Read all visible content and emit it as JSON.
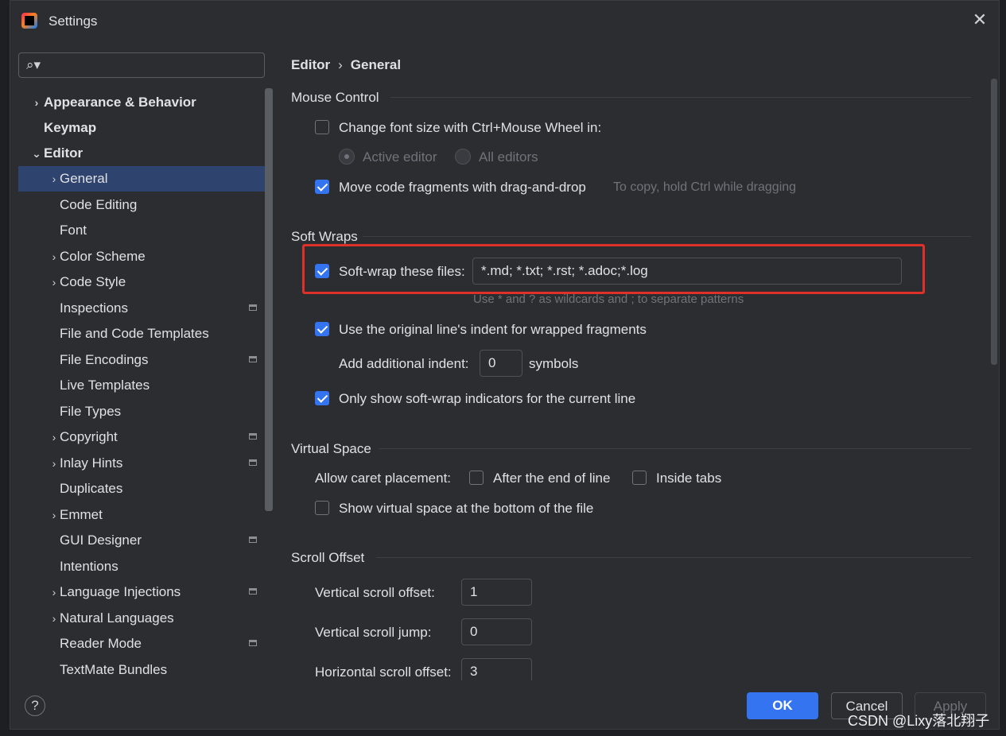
{
  "window": {
    "title": "Settings",
    "close_label": "✕"
  },
  "search": {
    "icon": "search-icon"
  },
  "sidebar": {
    "items": [
      {
        "label": "Appearance & Behavior",
        "chevron": "›"
      },
      {
        "label": "Keymap"
      },
      {
        "label": "Editor",
        "chevron": "⌄"
      },
      {
        "label": "General",
        "chevron": "›"
      },
      {
        "label": "Code Editing"
      },
      {
        "label": "Font"
      },
      {
        "label": "Color Scheme",
        "chevron": "›"
      },
      {
        "label": "Code Style",
        "chevron": "›"
      },
      {
        "label": "Inspections"
      },
      {
        "label": "File and Code Templates"
      },
      {
        "label": "File Encodings"
      },
      {
        "label": "Live Templates"
      },
      {
        "label": "File Types"
      },
      {
        "label": "Copyright",
        "chevron": "›"
      },
      {
        "label": "Inlay Hints",
        "chevron": "›"
      },
      {
        "label": "Duplicates"
      },
      {
        "label": "Emmet",
        "chevron": "›"
      },
      {
        "label": "GUI Designer"
      },
      {
        "label": "Intentions"
      },
      {
        "label": "Language Injections",
        "chevron": "›"
      },
      {
        "label": "Natural Languages",
        "chevron": "›"
      },
      {
        "label": "Reader Mode"
      },
      {
        "label": "TextMate Bundles"
      }
    ]
  },
  "breadcrumb": {
    "parent": "Editor",
    "separator": "›",
    "current": "General"
  },
  "mouse_control": {
    "title": "Mouse Control",
    "change_font": {
      "label": "Change font size with Ctrl+Mouse Wheel in:",
      "checked": false
    },
    "active_editor": {
      "label": "Active editor",
      "selected": true
    },
    "all_editors": {
      "label": "All editors",
      "selected": false
    },
    "move_code": {
      "label": "Move code fragments with drag-and-drop",
      "checked": true
    },
    "move_hint": "To copy, hold Ctrl while dragging"
  },
  "soft_wraps": {
    "title": "Soft Wraps",
    "soft_wrap_files": {
      "label": "Soft-wrap these files:",
      "checked": true,
      "value": "*.md; *.txt; *.rst; *.adoc;*.log"
    },
    "pattern_hint": "Use * and ? as wildcards and ; to separate patterns",
    "original_indent": {
      "label": "Use the original line's indent for wrapped fragments",
      "checked": true
    },
    "additional_indent": {
      "label": "Add additional indent:",
      "value": "0",
      "unit": "symbols"
    },
    "only_current_line": {
      "label": "Only show soft-wrap indicators for the current line",
      "checked": true
    }
  },
  "virtual_space": {
    "title": "Virtual Space",
    "caret_placement": "Allow caret placement:",
    "after_end": {
      "label": "After the end of line",
      "checked": false
    },
    "inside_tabs": {
      "label": "Inside tabs",
      "checked": false
    },
    "show_bottom": {
      "label": "Show virtual space at the bottom of the file",
      "checked": false
    }
  },
  "scroll_offset": {
    "title": "Scroll Offset",
    "vertical_offset": {
      "label": "Vertical scroll offset:",
      "value": "1"
    },
    "vertical_jump": {
      "label": "Vertical scroll jump:",
      "value": "0"
    },
    "horizontal_offset": {
      "label": "Horizontal scroll offset:",
      "value": "3"
    }
  },
  "footer": {
    "help": "?",
    "ok": "OK",
    "cancel": "Cancel",
    "apply": "Apply"
  },
  "watermark": "CSDN @Lixy落北翔子",
  "colors": {
    "accent": "#3574f0",
    "highlight": "#e0302a",
    "selection": "#2e436e"
  }
}
